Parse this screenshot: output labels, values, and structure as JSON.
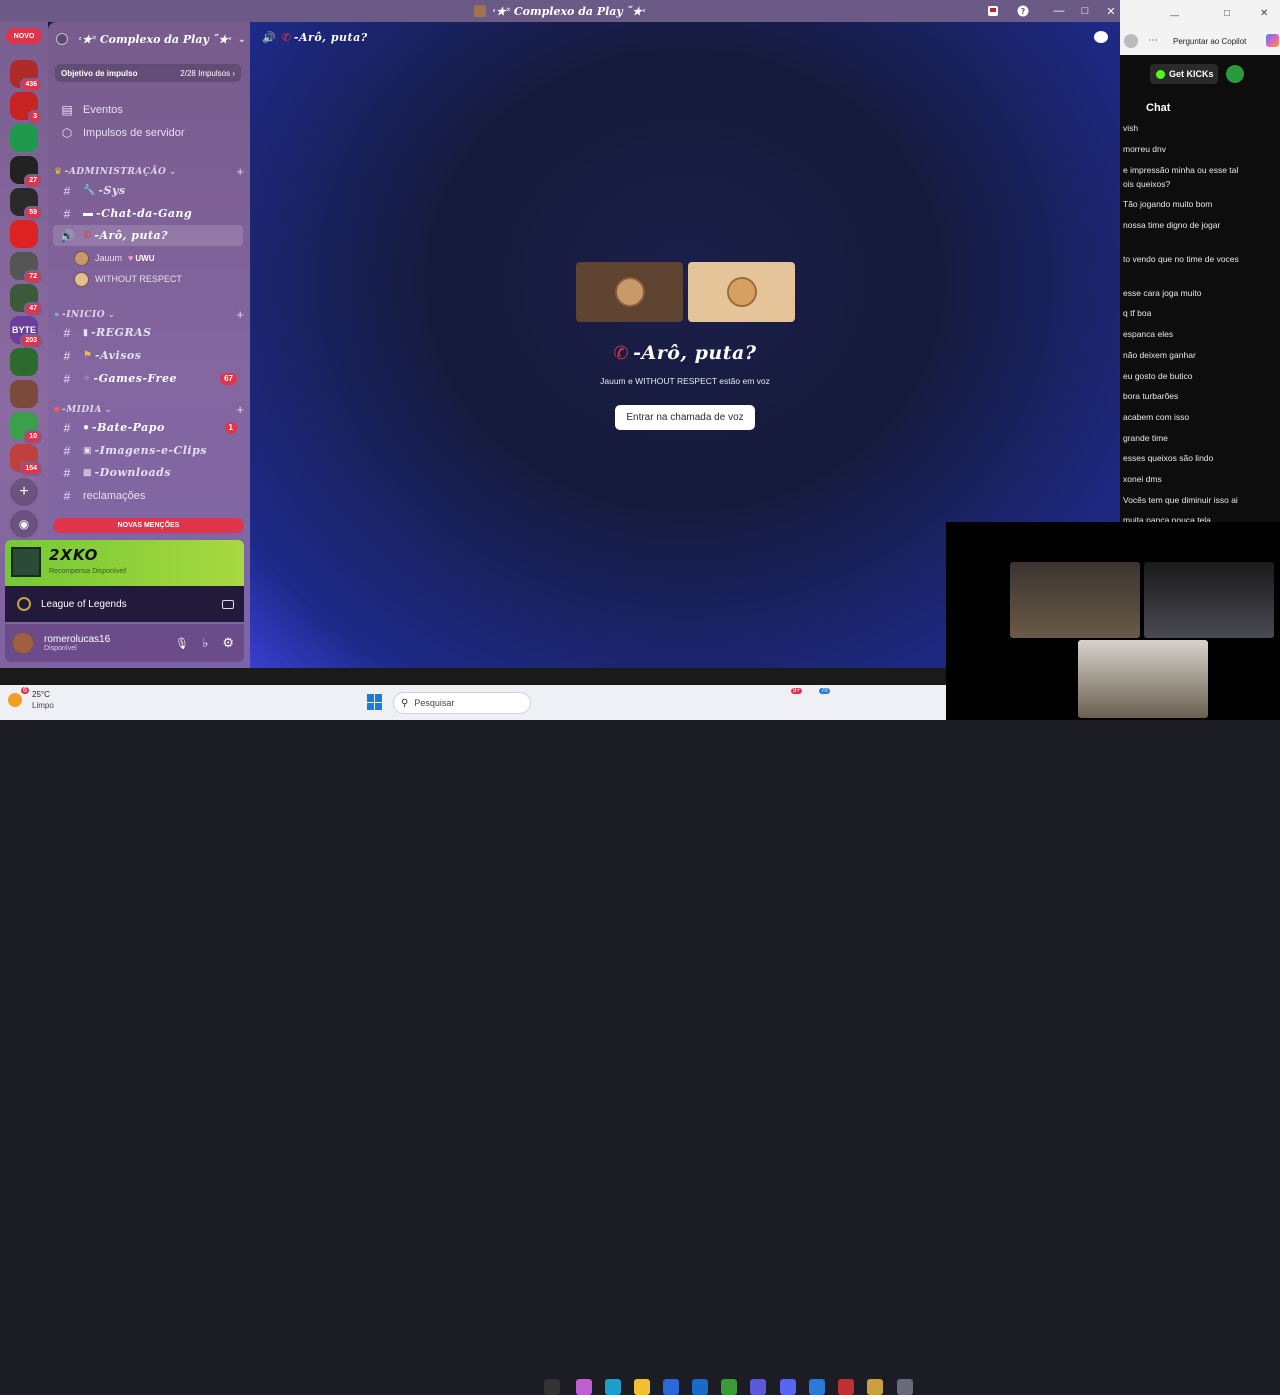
{
  "window": {
    "title": "˓★˟ Complexo da Play ˝★˓"
  },
  "guilds": {
    "new_label": "NOVO",
    "items": [
      {
        "badge": "436",
        "color": "#b02a2a"
      },
      {
        "badge": "3",
        "color": "#c82323"
      },
      {
        "badge": "",
        "color": "#1f9a4d"
      },
      {
        "badge": "27",
        "color": "#222"
      },
      {
        "badge": "59",
        "color": "#2a2a2a"
      },
      {
        "badge": "",
        "color": "#d22"
      },
      {
        "badge": "72",
        "color": "#555"
      },
      {
        "badge": "47",
        "color": "#3a5a3a"
      },
      {
        "badge": "203",
        "color": "#6a3f9a",
        "label": "BYTE"
      },
      {
        "badge": "",
        "color": "#2d6a2d"
      },
      {
        "badge": "",
        "color": "#7a4a3a"
      },
      {
        "badge": "10",
        "color": "#3aa04a"
      },
      {
        "badge": "154",
        "color": "#c04040"
      }
    ]
  },
  "sidebar": {
    "server_name": "˓★˟ Complexo da Play ˝★˓",
    "boost": {
      "label": "Objetivo de impulso",
      "value": "2/28 Impulsos"
    },
    "events": "Eventos",
    "server_boosts": "Impulsos de servidor",
    "cat_admin": "-ADMINISTRAÇÃO",
    "ch_sys": "-Sys",
    "ch_chat": "-Chat-da-Gang",
    "ch_voice": "-Arô, puta?",
    "voice_user1": "Jauum",
    "voice_user1_tag": "UWU",
    "voice_user2": "WITHOUT RESPECT",
    "cat_inicio": "-INICIO",
    "ch_regras": "-REGRAS",
    "ch_avisos": "-Avisos",
    "ch_games": "-Games-Free",
    "ch_games_badge": "67",
    "cat_midia": "-MIDIA",
    "ch_bate": "-Bate-Papo",
    "ch_bate_badge": "1",
    "ch_imagens": "-Imagens-e-Clips",
    "ch_downloads": "-Downloads",
    "ch_reclamacoes": "reclamações",
    "new_mentions": "NOVAS MENÇÕES",
    "promo_title": "2XKO",
    "promo_sub": "Recompensa Disponível!",
    "game": "League of Legends",
    "username": "romerolucas16",
    "status": "Disponível"
  },
  "main": {
    "channel_title": "-Arô, puta?",
    "voice_title": "-Arô, puta?",
    "voice_sub": "Jauum e WITHOUT RESPECT estão em voz",
    "join_button": "Entrar na chamada de voz"
  },
  "copilot": {
    "ask": "Perguntar ao Copilot",
    "get_kicks": "Get KICKs",
    "chat_title": "Chat",
    "messages": [
      "vish",
      "morreu dnv",
      "e impressão minha ou esse tal",
      "ois queixos?",
      "Tão jogando muito bom",
      "nossa time digno de jogar",
      "to vendo que no time de voces",
      "esse cara joga muito",
      "q tf boa",
      "espanca eles",
      "não deixem ganhar",
      "eu gosto de butico",
      "bora turbarões",
      "acabem com isso",
      "grande time",
      "esses queixos são lindo",
      "xonei dms",
      "Vocês tem que diminuir isso ai",
      "muita panca pouca tela"
    ]
  },
  "taskbar": {
    "temp": "25°C",
    "weather": "Limpo",
    "weather_badge": "6",
    "search_placeholder": "Pesquisar",
    "discord_badge": "9+",
    "teams_badge": "70"
  }
}
